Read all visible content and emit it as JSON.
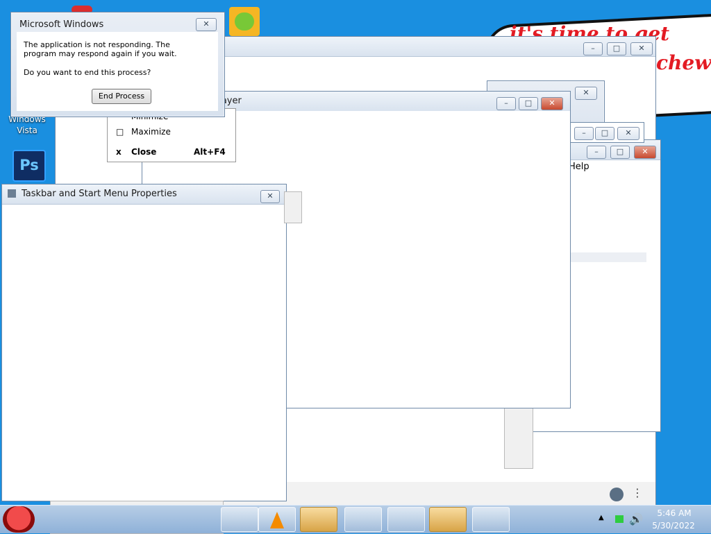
{
  "desktop": {
    "icons": [
      {
        "label": "Windows\nVista",
        "name": "windows-vista-icon"
      },
      {
        "label": "",
        "name": "photoshop-icon",
        "glyph": "Ps"
      }
    ],
    "cloud_lines": [
      "it's time to get shit",
      "chew"
    ]
  },
  "dialog": {
    "title": "Microsoft Windows",
    "message_1": "The application is not responding. The program may respond again if you wait.",
    "message_2": "Do you want to end this process?",
    "end_button": "End Process"
  },
  "system_menu": {
    "items": [
      {
        "label": "Minimize",
        "glyph": "—",
        "shortcut": ""
      },
      {
        "label": "Maximize",
        "glyph": "□",
        "shortcut": ""
      },
      {
        "label": "Close",
        "glyph": "x",
        "shortcut": "Alt+F4"
      }
    ]
  },
  "vlc": {
    "title": "VLC media player"
  },
  "taskbar_props": {
    "title": "Taskbar and Start Menu Properties"
  },
  "side_window": {
    "menu_help": "Help"
  },
  "clock": {
    "time": "5:46 AM",
    "date": "5/30/2022"
  },
  "taskbar": {
    "items": [
      "calculator",
      "vlc",
      "folder-photos",
      "game",
      "puzzle",
      "remote-desktop",
      "server-manager"
    ]
  },
  "colors": {
    "desktop": "#1a8fe0",
    "close_red": "#c74a2f",
    "vlc_orange": "#f48b00"
  }
}
